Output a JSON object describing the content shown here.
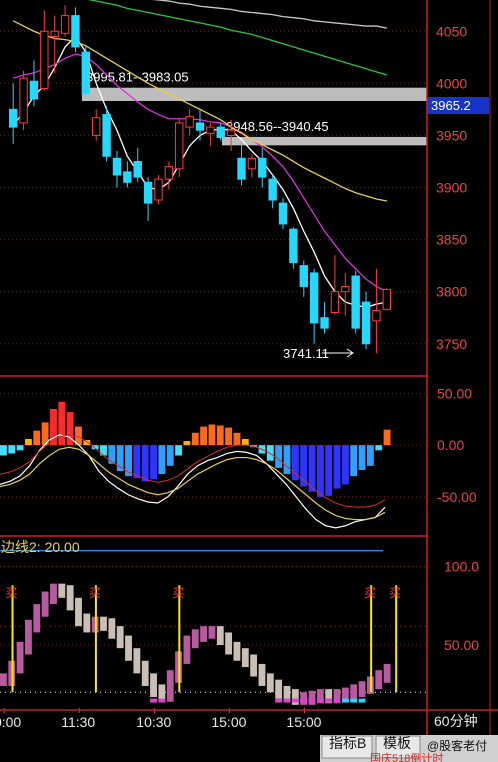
{
  "chart_data": [
    {
      "type": "candlestick",
      "ylim": [
        3720,
        4080
      ],
      "y_ticks": [
        4050,
        4000,
        3950,
        3900,
        3850,
        3800,
        3750
      ],
      "current_price": "3965.2",
      "candles": [
        {
          "o": 3975,
          "h": 4000,
          "l": 3942,
          "c": 3958
        },
        {
          "o": 3962,
          "h": 4012,
          "l": 3955,
          "c": 4005
        },
        {
          "o": 4002,
          "h": 4022,
          "l": 3978,
          "c": 3985
        },
        {
          "o": 3995,
          "h": 4070,
          "l": 3993,
          "c": 4050
        },
        {
          "o": 4045,
          "h": 4065,
          "l": 4010,
          "c": 4050
        },
        {
          "o": 4048,
          "h": 4075,
          "l": 4045,
          "c": 4065
        },
        {
          "o": 4065,
          "h": 4073,
          "l": 4030,
          "c": 4035
        },
        {
          "o": 4030,
          "h": 4037,
          "l": 3985,
          "c": 3990
        },
        {
          "o": 3950,
          "h": 3975,
          "l": 3945,
          "c": 3967
        },
        {
          "o": 3970,
          "h": 3978,
          "l": 3925,
          "c": 3930
        },
        {
          "o": 3928,
          "h": 3935,
          "l": 3900,
          "c": 3912
        },
        {
          "o": 3915,
          "h": 3925,
          "l": 3900,
          "c": 3905
        },
        {
          "o": 3925,
          "h": 3938,
          "l": 3905,
          "c": 3910
        },
        {
          "o": 3905,
          "h": 3910,
          "l": 3868,
          "c": 3885
        },
        {
          "o": 3888,
          "h": 3912,
          "l": 3884,
          "c": 3908
        },
        {
          "o": 3908,
          "h": 3925,
          "l": 3898,
          "c": 3920
        },
        {
          "o": 3918,
          "h": 3966,
          "l": 3910,
          "c": 3962
        },
        {
          "o": 3958,
          "h": 3975,
          "l": 3950,
          "c": 3968
        },
        {
          "o": 3962,
          "h": 3975,
          "l": 3945,
          "c": 3955
        },
        {
          "o": 3952,
          "h": 3962,
          "l": 3940,
          "c": 3958
        },
        {
          "o": 3958,
          "h": 3962,
          "l": 3945,
          "c": 3948
        },
        {
          "o": 3950,
          "h": 3965,
          "l": 3935,
          "c": 3955
        },
        {
          "o": 3928,
          "h": 3944,
          "l": 3902,
          "c": 3908
        },
        {
          "o": 3918,
          "h": 3932,
          "l": 3910,
          "c": 3928
        },
        {
          "o": 3928,
          "h": 3938,
          "l": 3900,
          "c": 3910
        },
        {
          "o": 3908,
          "h": 3912,
          "l": 3880,
          "c": 3888
        },
        {
          "o": 3885,
          "h": 3890,
          "l": 3860,
          "c": 3865
        },
        {
          "o": 3860,
          "h": 3862,
          "l": 3822,
          "c": 3828
        },
        {
          "o": 3825,
          "h": 3830,
          "l": 3795,
          "c": 3805
        },
        {
          "o": 3818,
          "h": 3822,
          "l": 3750,
          "c": 3770
        },
        {
          "o": 3775,
          "h": 3790,
          "l": 3760,
          "c": 3765
        },
        {
          "o": 3780,
          "h": 3835,
          "l": 3778,
          "c": 3800
        },
        {
          "o": 3800,
          "h": 3818,
          "l": 3777,
          "c": 3805
        },
        {
          "o": 3815,
          "h": 3820,
          "l": 3760,
          "c": 3765
        },
        {
          "o": 3790,
          "h": 3800,
          "l": 3745,
          "c": 3750
        },
        {
          "o": 3772,
          "h": 3822,
          "l": 3741,
          "c": 3782
        },
        {
          "o": 3783,
          "h": 3803,
          "l": 3782,
          "c": 3802
        }
      ],
      "ma_series": [
        {
          "color": "#ffffff",
          "values": [
            3960,
            3972,
            3988,
            3998,
            4015,
            4035,
            4045,
            4030,
            4000,
            3975,
            3955,
            3930,
            3915,
            3900,
            3898,
            3905,
            3922,
            3940,
            3950,
            3955,
            3956,
            3955,
            3946,
            3935,
            3925,
            3912,
            3898,
            3880,
            3858,
            3838,
            3815,
            3800,
            3790,
            3787,
            3785,
            3788,
            3790
          ]
        },
        {
          "color": "#dd2fdf",
          "values": [
            4005,
            4008,
            4010,
            4014,
            4018,
            4024,
            4028,
            4026,
            4018,
            4008,
            3998,
            3990,
            3982,
            3975,
            3970,
            3966,
            3966,
            3966,
            3965,
            3963,
            3962,
            3958,
            3953,
            3946,
            3939,
            3930,
            3920,
            3906,
            3890,
            3874,
            3858,
            3845,
            3832,
            3822,
            3812,
            3805,
            3800
          ]
        },
        {
          "color": "#e6d23c",
          "values": [
            4060,
            4055,
            4050,
            4046,
            4043,
            4042,
            4040,
            4036,
            4030,
            4024,
            4018,
            4012,
            4006,
            4000,
            3995,
            3990,
            3985,
            3980,
            3975,
            3970,
            3965,
            3958,
            3952,
            3946,
            3941,
            3936,
            3931,
            3925,
            3919,
            3914,
            3909,
            3904,
            3899,
            3895,
            3892,
            3889,
            3887
          ]
        },
        {
          "color": "#27c83a",
          "values": [
            4090,
            4088,
            4086,
            4085,
            4084,
            4083,
            4082,
            4081,
            4079,
            4077,
            4075,
            4072,
            4070,
            4068,
            4066,
            4064,
            4062,
            4060,
            4058,
            4056,
            4054,
            4051,
            4049,
            4047,
            4044,
            4041,
            4038,
            4035,
            4032,
            4029,
            4026,
            4023,
            4020,
            4017,
            4014,
            4011,
            4008
          ]
        },
        {
          "color": "#2e2fd6",
          "values": [
            4125,
            4124,
            4123,
            4122,
            4122,
            4121,
            4120,
            4119,
            4118,
            4117,
            4116,
            4115,
            4114,
            4113,
            4112,
            4111,
            4110,
            4109,
            4108,
            4107,
            4106,
            4105,
            4104,
            4103,
            4102,
            4101,
            4100,
            4099,
            4098,
            4097,
            4096,
            4095,
            4094,
            4093,
            4092,
            4091,
            4090
          ]
        },
        {
          "color": "#c8c8c8",
          "values": [
            4098,
            4097,
            4096,
            4094,
            4093,
            4091,
            4090,
            4089,
            4088,
            4086,
            4085,
            4084,
            4082,
            4081,
            4080,
            4079,
            4077,
            4076,
            4074,
            4073,
            4072,
            4071,
            4069,
            4068,
            4067,
            4066,
            4064,
            4063,
            4062,
            4060,
            4059,
            4058,
            4057,
            4056,
            4055,
            4055,
            4053
          ]
        }
      ],
      "zones": [
        {
          "hi": 3995.81,
          "lo": 3983.05,
          "label": "3995.81--3983.05"
        },
        {
          "hi": 3948.56,
          "lo": 3940.45,
          "label": "3948.56--3940.45"
        }
      ],
      "low_marker": "3741.11"
    },
    {
      "type": "macd",
      "ylim": [
        -85,
        65
      ],
      "y_ticks": [
        "50.00",
        "0.00",
        "-50.00"
      ],
      "hist": [
        -10,
        -8,
        -5,
        6,
        14,
        22,
        35,
        42,
        32,
        18,
        5,
        -4,
        -10,
        -18,
        -25,
        -30,
        -32,
        -35,
        -33,
        -28,
        -20,
        -10,
        4,
        12,
        18,
        20,
        19,
        17,
        12,
        6,
        -2,
        -8,
        -15,
        -22,
        -28,
        -34,
        -40,
        -45,
        -50,
        -49,
        -42,
        -38,
        -30,
        -24,
        -20,
        -5,
        15
      ],
      "dif": [
        -38,
        -35,
        -30,
        -20,
        -5,
        5,
        10,
        8,
        0,
        -10,
        -25,
        -35,
        -42,
        -48,
        -52,
        -55,
        -56,
        -50,
        -40,
        -28,
        -20,
        -15,
        -12,
        -8,
        -6,
        -7,
        -10,
        -18,
        -28,
        -38,
        -50,
        -62,
        -72,
        -78,
        -80,
        -78,
        -74,
        -72,
        -70,
        -60
      ],
      "dea": [
        -40,
        -38,
        -34,
        -28,
        -18,
        -10,
        -4,
        -2,
        -4,
        -10,
        -18,
        -26,
        -32,
        -38,
        -42,
        -46,
        -48,
        -46,
        -42,
        -35,
        -28,
        -23,
        -18,
        -14,
        -12,
        -12,
        -14,
        -18,
        -24,
        -32,
        -40,
        -48,
        -56,
        -63,
        -68,
        -71,
        -72,
        -72,
        -70,
        -65
      ]
    },
    {
      "type": "indicator",
      "title": "边线2: 20.00",
      "ylim": [
        10,
        118
      ],
      "y_ticks": [
        "100.0",
        "50.00"
      ],
      "ref_line": 110,
      "values": [
        28,
        36,
        48,
        62,
        72,
        80,
        85,
        84,
        76,
        66,
        62,
        64,
        63,
        58,
        52,
        44,
        36,
        28,
        21,
        18,
        30,
        42,
        52,
        56,
        58,
        58,
        54,
        48,
        44,
        40,
        34,
        28,
        24,
        20,
        18,
        16,
        16,
        17,
        18,
        17,
        18,
        19,
        21,
        23,
        26,
        30,
        34
      ],
      "buy_label": "买",
      "buy_signals": [
        1,
        11,
        21,
        44,
        47
      ],
      "x_ticks": [
        {
          "i": 0,
          "label": "10:00"
        },
        {
          "i": 9,
          "label": "11:30"
        },
        {
          "i": 18,
          "label": "10:30"
        },
        {
          "i": 27,
          "label": "15:00"
        },
        {
          "i": 36,
          "label": "15:00"
        }
      ]
    }
  ],
  "period_label": "60分钟",
  "tabs": [
    "指标B",
    "模板"
  ],
  "watermark": "@股客老付",
  "bottom_text": "国庆518倒计时"
}
